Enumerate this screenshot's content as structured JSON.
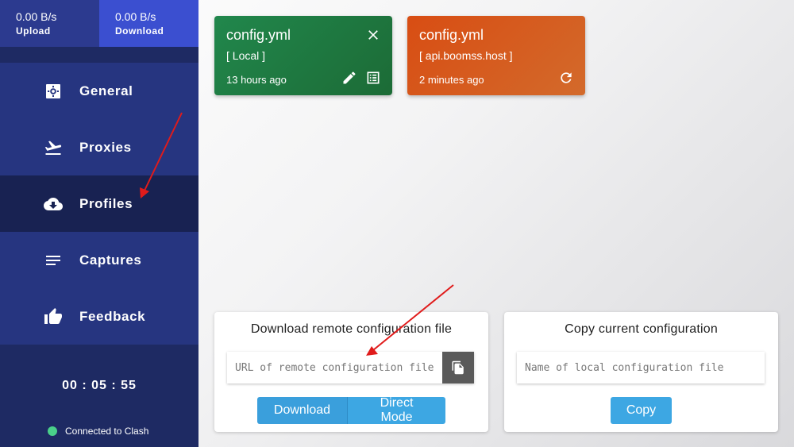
{
  "speed": {
    "upload_value": "0.00 B/s",
    "upload_label": "Upload",
    "download_value": "0.00 B/s",
    "download_label": "Download"
  },
  "nav": {
    "items": [
      {
        "label": "General",
        "icon": "gear-icon"
      },
      {
        "label": "Proxies",
        "icon": "plane-icon"
      },
      {
        "label": "Profiles",
        "icon": "cloud-download-icon",
        "active": true
      },
      {
        "label": "Captures",
        "icon": "list-icon"
      },
      {
        "label": "Feedback",
        "icon": "thumbs-up-icon"
      }
    ]
  },
  "timer": "00 : 05 : 55",
  "status": {
    "text": "Connected to Clash",
    "color": "#4ad08a"
  },
  "profiles": [
    {
      "name": "config.yml",
      "source": "[ Local ]",
      "time": "13 hours ago",
      "color": "#21874c"
    },
    {
      "name": "config.yml",
      "source": "[ api.boomss.host ]",
      "time": "2 minutes ago",
      "color": "#d84d13"
    }
  ],
  "download_panel": {
    "title": "Download remote configuration file",
    "url_placeholder": "URL of remote configuration file",
    "url_value": "",
    "download_label": "Download",
    "direct_label": "Direct Mode"
  },
  "copy_panel": {
    "title": "Copy current configuration",
    "name_placeholder": "Name of local configuration file",
    "name_value": "",
    "copy_label": "Copy"
  },
  "colors": {
    "sidebar": "#1e2a63",
    "accent_blue": "#3da7e3",
    "annotation_arrow": "#e01b1b"
  }
}
